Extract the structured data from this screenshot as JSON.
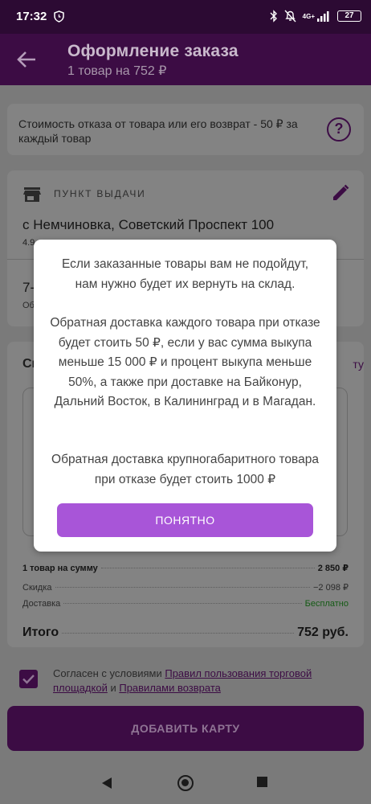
{
  "status_bar": {
    "time": "17:32",
    "network": "4G+",
    "battery": "27"
  },
  "app_bar": {
    "title": "Оформление заказа",
    "subtitle": "1 товар на 752 ₽"
  },
  "notice": {
    "text": "Стоимость отказа от товара или его возврат - 50 ₽ за каждый товар"
  },
  "pickup": {
    "header": "ПУНКТ ВЫДАЧИ",
    "address": "с Немчиновка, Советский Проспект 100",
    "rating": "4.9",
    "delivery_date": "7-",
    "delivery_note": "Об"
  },
  "payment": {
    "title": "Сп",
    "change": "ту"
  },
  "summary": {
    "items_label": "1 товар на сумму",
    "items_value": "2 850 ₽",
    "discount_label": "Скидка",
    "discount_value": "−2 098 ₽",
    "delivery_label": "Доставка",
    "delivery_value": "Бесплатно",
    "total_label": "Итого",
    "total_value": "752 руб."
  },
  "consent": {
    "text_prefix": "Согласен с условиями ",
    "link1": "Правил пользования торговой площадкой",
    "text_mid": " и ",
    "link2": "Правилами возврата"
  },
  "add_card_button": "ДОБАВИТЬ КАРТУ",
  "modal": {
    "p1": "Если заказанные товары вам не подойдут, нам нужно будет их вернуть на склад.",
    "p2": "Обратная доставка каждого товара при отказе будет стоить 50 ₽, если у вас сумма выкупа меньше 15 000 ₽ и процент выкупа меньше 50%, а также при доставке на Байконур, Дальний Восток, в Калининград и в Магадан.",
    "p3": "Обратная доставка крупногабаритного товара при отказе будет стоить 1000 ₽",
    "button": "ПОНЯТНО"
  },
  "colors": {
    "brand": "#3c0c44",
    "modal_button": "#a855d8",
    "status_bar": "#2c0a33"
  },
  "icons": [
    "back-arrow-icon",
    "question-icon",
    "store-icon",
    "edit-icon",
    "check-icon",
    "bluetooth-icon",
    "mute-icon",
    "signal-icon",
    "battery-icon",
    "nav-back-icon",
    "nav-home-icon",
    "nav-recent-icon"
  ]
}
